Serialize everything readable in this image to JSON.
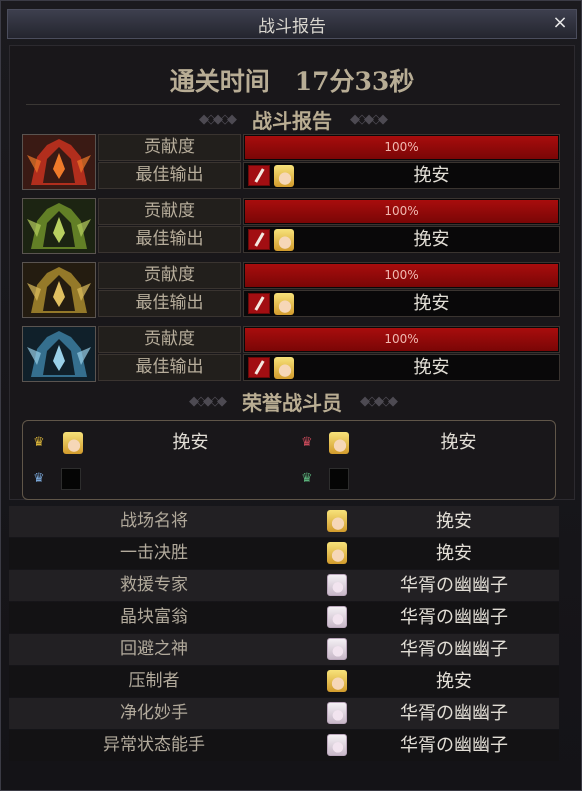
{
  "window": {
    "title": "战斗报告",
    "close_symbol": "×"
  },
  "clear_time": "通关时间　17分33秒",
  "sections": {
    "report": "战斗报告",
    "honor": "荣誉战斗员"
  },
  "bosses": [
    {
      "icon": "red-boss-portrait-icon",
      "contribution_label": "贡献度",
      "contribution_value": "100%",
      "contribution_fraction": 1.0,
      "best_output_label": "最佳输出",
      "best_output_player": "挽安"
    },
    {
      "icon": "green-boss-portrait-icon",
      "contribution_label": "贡献度",
      "contribution_value": "100%",
      "contribution_fraction": 1.0,
      "best_output_label": "最佳输出",
      "best_output_player": "挽安"
    },
    {
      "icon": "gold-boss-portrait-icon",
      "contribution_label": "贡献度",
      "contribution_value": "100%",
      "contribution_fraction": 1.0,
      "best_output_label": "最佳输出",
      "best_output_player": "挽安"
    },
    {
      "icon": "blue-boss-portrait-icon",
      "contribution_label": "贡献度",
      "contribution_value": "100%",
      "contribution_fraction": 1.0,
      "best_output_label": "最佳输出",
      "best_output_player": "挽安"
    }
  ],
  "honor_members": [
    {
      "crown": "gold-crown-icon",
      "name": "挽安"
    },
    {
      "crown": "red-crown-icon",
      "name": "挽安"
    },
    {
      "crown": "blue-crown-icon",
      "name": ""
    },
    {
      "crown": "green-crown-icon",
      "name": ""
    }
  ],
  "awards": [
    {
      "title": "战场名将",
      "name": "挽安"
    },
    {
      "title": "一击决胜",
      "name": "挽安"
    },
    {
      "title": "救援专家",
      "name": "华胥の幽幽子"
    },
    {
      "title": "晶块富翁",
      "name": "华胥の幽幽子"
    },
    {
      "title": "回避之神",
      "name": "华胥の幽幽子"
    },
    {
      "title": "压制者",
      "name": "挽安"
    },
    {
      "title": "净化妙手",
      "name": "华胥の幽幽子"
    },
    {
      "title": "异常状态能手",
      "name": "华胥の幽幽子"
    }
  ],
  "colors": {
    "bar_red": "#a80d0d",
    "title_gold": "#b9ad93"
  }
}
